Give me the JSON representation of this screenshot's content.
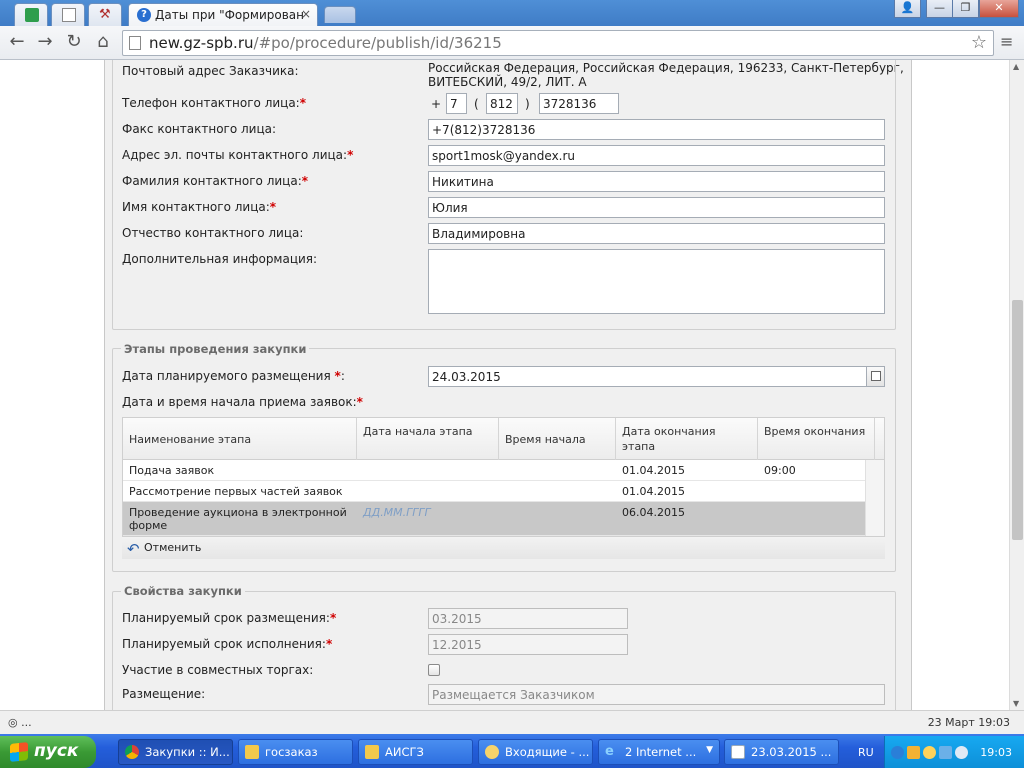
{
  "browser": {
    "tab_title": "Даты при \"Формирование и",
    "tab_close": "×",
    "url_host": "new.gz-spb.ru",
    "url_path": "/#po/procedure/publish/id/36215",
    "star": "☆",
    "menu": "≡",
    "back": "←",
    "forward": "→",
    "reload": "↻",
    "home": "⌂",
    "win_user": "👤",
    "win_min": "—",
    "win_max": "❐",
    "win_close": "✕"
  },
  "form": {
    "postal_label": "Почтовый адрес Заказчика:",
    "postal_value_1": "Российская Федерация, Российская Федерация, 196233, Санкт-Петербург,",
    "postal_value_2": "ВИТЕБСКИЙ, 49/2, ЛИТ. А",
    "phone_label": "Телефон контактного лица:",
    "phone_plus": "+",
    "phone_country": "7",
    "phone_open": "(",
    "phone_code": "812",
    "phone_close": ")",
    "phone_number": "3728136",
    "fax_label": "Факс контактного лица:",
    "fax_value": "+7(812)3728136",
    "email_label": "Адрес эл. почты контактного лица:",
    "email_value": "sport1mosk@yandex.ru",
    "lastname_label": "Фамилия контактного лица:",
    "lastname_value": "Никитина",
    "firstname_label": "Имя контактного лица:",
    "firstname_value": "Юлия",
    "middlename_label": "Отчество контактного лица:",
    "middlename_value": "Владимировна",
    "extra_label": "Дополнительная информация:",
    "extra_value": "",
    "required_mark": "*"
  },
  "stages": {
    "legend": "Этапы проведения закупки",
    "planned_date_label": "Дата планируемого размещения",
    "planned_date_colon": ":",
    "planned_date_value": "24.03.2015",
    "start_datetime_label": "Дата и время начала приема заявок:",
    "columns": [
      "Наименование этапа",
      "Дата начала этапа",
      "Время начала",
      "Дата окончания этапа",
      "Время окончания"
    ],
    "rows": [
      {
        "name": "Подача заявок",
        "start_date": "",
        "start_time": "",
        "end_date": "01.04.2015",
        "end_time": "09:00"
      },
      {
        "name": "Рассмотрение первых частей заявок",
        "start_date": "",
        "start_time": "",
        "end_date": "01.04.2015",
        "end_time": ""
      },
      {
        "name": "Проведение аукциона в электронной форме",
        "start_date": "ДД.ММ.ГГГГ",
        "start_time": "",
        "end_date": "06.04.2015",
        "end_time": ""
      }
    ],
    "undo_label": "Отменить"
  },
  "props": {
    "legend": "Свойства закупки",
    "planned_period_label": "Планируемый срок размещения:",
    "planned_period_value": "03.2015",
    "execution_period_label": "Планируемый срок исполнения:",
    "execution_period_value": "12.2015",
    "joint_label": "Участие в совместных торгах:",
    "placement_label": "Размещение:",
    "placement_value": "Размещается Заказчиком"
  },
  "status": {
    "left": "◎ ...",
    "right": "23 Март 19:03"
  },
  "taskbar": {
    "start": "пуск",
    "items": [
      "Закупки :: И...",
      "госзаказ",
      "АИСГЗ",
      "Входящие - ...",
      "2 Internet ...",
      "23.03.2015 ..."
    ],
    "lang": "RU",
    "clock": "19:03"
  },
  "colors": {
    "required": "#d00000",
    "selected_row": "#c8c8c8",
    "placeholder": "#7f9fc6",
    "taskbar": "#245edb",
    "start_button": "#3a9a35"
  }
}
